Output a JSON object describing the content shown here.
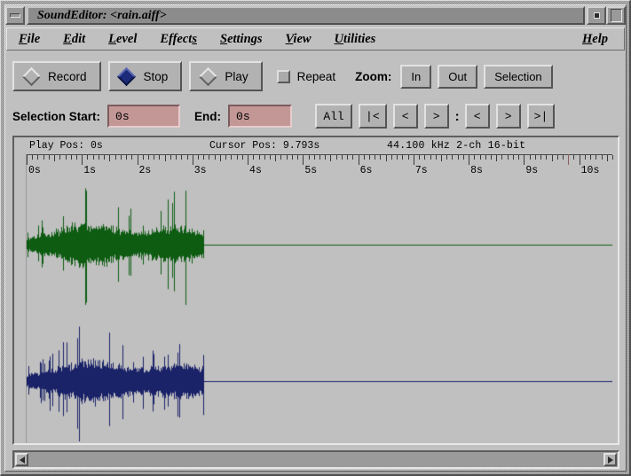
{
  "window": {
    "title": "SoundEditor: <rain.aiff>",
    "minimize_icon": "minimize-icon",
    "maximize_icon": "maximize-icon",
    "restore_icon": "restore-icon"
  },
  "menubar": {
    "items": [
      {
        "label": "File",
        "mnemonic": "F"
      },
      {
        "label": "Edit",
        "mnemonic": "E"
      },
      {
        "label": "Level",
        "mnemonic": "L"
      },
      {
        "label": "Effects",
        "mnemonic": "s"
      },
      {
        "label": "Settings",
        "mnemonic": "S"
      },
      {
        "label": "View",
        "mnemonic": "V"
      },
      {
        "label": "Utilities",
        "mnemonic": "U"
      }
    ],
    "help": {
      "label": "Help",
      "mnemonic": "H"
    }
  },
  "toolbar": {
    "record_label": "Record",
    "record_active": false,
    "stop_label": "Stop",
    "stop_active": true,
    "play_label": "Play",
    "play_active": false,
    "repeat_label": "Repeat",
    "repeat_checked": false,
    "zoom_label": "Zoom:",
    "zoom_in_label": "In",
    "zoom_out_label": "Out",
    "zoom_selection_label": "Selection"
  },
  "selection": {
    "start_label": "Selection Start:",
    "start_value": "0s",
    "start_placeholder": "0s",
    "end_label": "End:",
    "end_value": "0s",
    "end_placeholder": "0s",
    "nav_left": [
      {
        "label": "All",
        "name": "select-all-button"
      },
      {
        "label": "|<",
        "name": "start-to-begin-button"
      },
      {
        "label": "<",
        "name": "start-back-button"
      },
      {
        "label": ">",
        "name": "start-forward-button"
      }
    ],
    "separator": ":",
    "nav_right": [
      {
        "label": "<",
        "name": "end-back-button"
      },
      {
        "label": ">",
        "name": "end-forward-button"
      },
      {
        "label": ">|",
        "name": "end-to-finish-button"
      }
    ]
  },
  "info": {
    "play_pos": "Play Pos: 0s",
    "cursor_pos": "Cursor Pos: 9.793s",
    "format": "44.100 kHz  2-ch  16-bit"
  },
  "ruler": {
    "labels": [
      "0s",
      "1s",
      "2s",
      "3s",
      "4s",
      "5s",
      "6s",
      "7s",
      "8s",
      "9s",
      "10s"
    ],
    "seconds_visible": 10.6,
    "minor_ticks_per_second": 10
  },
  "waveform": {
    "cursor_time_s": 9.793,
    "audio_duration_s": 3.2,
    "channels": [
      {
        "name": "left",
        "color": "#0d5c12",
        "zero_line_color": "#0d5c12"
      },
      {
        "name": "right",
        "color": "#1a2268",
        "zero_line_color": "#1a2268"
      }
    ]
  },
  "scrollbar": {
    "left_arrow_icon": "arrow-left-icon",
    "right_arrow_icon": "arrow-right-icon"
  },
  "colors": {
    "face": "#c0c0c0",
    "button_face": "#b2b2b2",
    "titlebar": "#8c8c8c",
    "textfield": "#c49797",
    "wave_left": "#0d5c12",
    "wave_right": "#1a2268",
    "cursor": "#8b5f5f"
  }
}
